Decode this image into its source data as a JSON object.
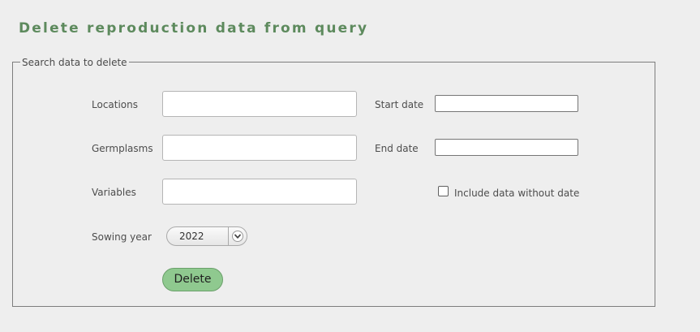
{
  "page": {
    "title": "Delete reproduction data from query"
  },
  "form": {
    "legend": "Search data to delete",
    "locations_label": "Locations",
    "locations_value": "",
    "germplasms_label": "Germplasms",
    "germplasms_value": "",
    "variables_label": "Variables",
    "variables_value": "",
    "start_date_label": "Start date",
    "start_date_value": "",
    "end_date_label": "End date",
    "end_date_value": "",
    "include_without_date_label": "Include data without date",
    "include_without_date_checked": false,
    "sowing_year_label": "Sowing year",
    "sowing_year_value": "2022",
    "sowing_year_icon": "chevron-down-icon",
    "delete_label": "Delete"
  },
  "colors": {
    "title": "#5d8a5d",
    "delete_button": "#8fc98f",
    "background": "#eeeeee"
  }
}
